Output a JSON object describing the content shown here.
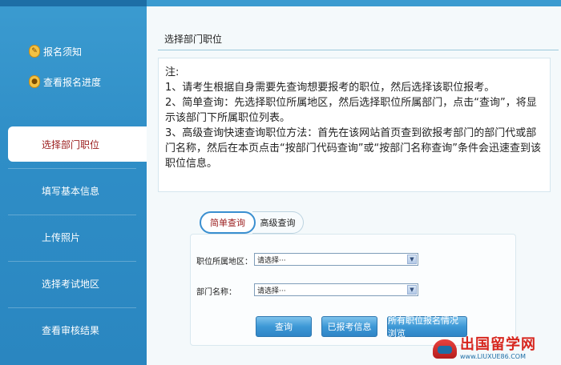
{
  "sidebar": {
    "items": [
      {
        "label": "报名须知",
        "icon": "info-icon"
      },
      {
        "label": "查看报名进度",
        "icon": "progress-icon"
      },
      {
        "label": "选择部门职位"
      },
      {
        "label": "填写基本信息"
      },
      {
        "label": "上传照片"
      },
      {
        "label": "选择考试地区"
      },
      {
        "label": "查看审核结果"
      }
    ],
    "active_index": 2
  },
  "main": {
    "title": "选择部门职位",
    "note": {
      "heading": "注:",
      "lines": [
        "1、请考生根据自身需要先查询想要报考的职位，然后选择该职位报考。",
        "2、简单查询：先选择职位所属地区，然后选择职位所属部门，点击“查询”，将显示该部门下所属职位列表。",
        "3、高级查询快速查询职位方法：首先在该网站首页查到欲报考部门的部门代或部门名称，然后在本页点击“按部门代码查询”或“按部门名称查询”条件会迅速查到该职位信息。"
      ]
    },
    "tabs": [
      {
        "label": "简单查询",
        "active": true
      },
      {
        "label": "高级查询",
        "active": false
      }
    ],
    "fields": [
      {
        "label": "职位所属地区：",
        "value": "请选择···"
      },
      {
        "label": "部门名称：",
        "value": "请选择···"
      }
    ],
    "buttons": {
      "query": "查询",
      "applied_info": "已报考信息",
      "all_positions": "所有职位报名情况浏览"
    }
  },
  "watermark": {
    "text": "出国留学网",
    "url": "www.LIUXUE86.COM"
  },
  "colors": {
    "sidebar_bg": "#2f8ec7",
    "active_text": "#9a1b1b",
    "button_bg": "#3d98d6",
    "logo_red": "#d7261e"
  }
}
